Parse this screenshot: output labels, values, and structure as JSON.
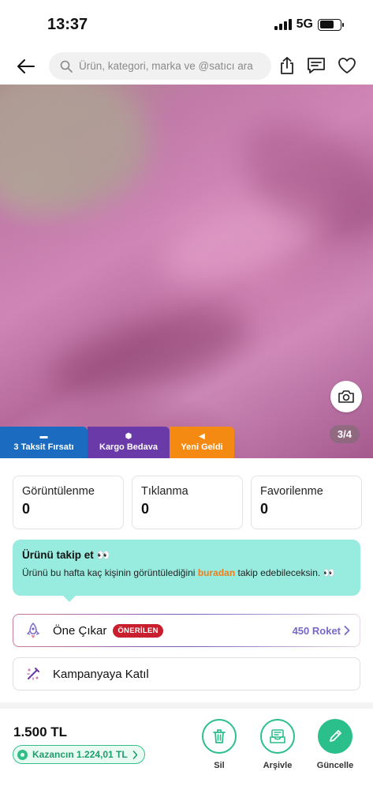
{
  "status_bar": {
    "time": "13:37",
    "network": "5G"
  },
  "nav": {
    "search_placeholder": "Ürün, kategori, marka ve @satıcı ara"
  },
  "product": {
    "page_counter": "3/4",
    "badges": [
      {
        "label": "3 Taksit Fırsatı",
        "icon": "card-icon",
        "color": "#1b6cc0"
      },
      {
        "label": "Kargo Bedava",
        "icon": "box-icon",
        "color": "#6a3aa8"
      },
      {
        "label": "Yeni Geldi",
        "icon": "megaphone-icon",
        "color": "#f58a12"
      }
    ]
  },
  "stats": [
    {
      "label": "Görüntülenme",
      "value": "0"
    },
    {
      "label": "Tıklanma",
      "value": "0"
    },
    {
      "label": "Favorilenme",
      "value": "0"
    }
  ],
  "info": {
    "title": "Ürünü takip et 👀",
    "text_before": "Ürünü bu hafta kaç kişinin görüntülediğini ",
    "link": "buradan",
    "text_after": " takip edebileceksin. 👀"
  },
  "boost": {
    "label": "Öne Çıkar",
    "tag": "ÖNERİLEN",
    "price": "450 Roket"
  },
  "campaign": {
    "label": "Kampanyaya Katıl"
  },
  "bottom": {
    "price": "1.500 TL",
    "earnings": "Kazancın 1.224,01 TL",
    "actions": {
      "delete": "Sil",
      "archive": "Arşivle",
      "update": "Güncelle"
    }
  },
  "colors": {
    "accent_green": "#2bbf8b",
    "info_bg": "#98ecdf",
    "link_orange": "#f07c1a",
    "rocket_purple": "#7a67c9",
    "recommend_red": "#c81e2d"
  }
}
